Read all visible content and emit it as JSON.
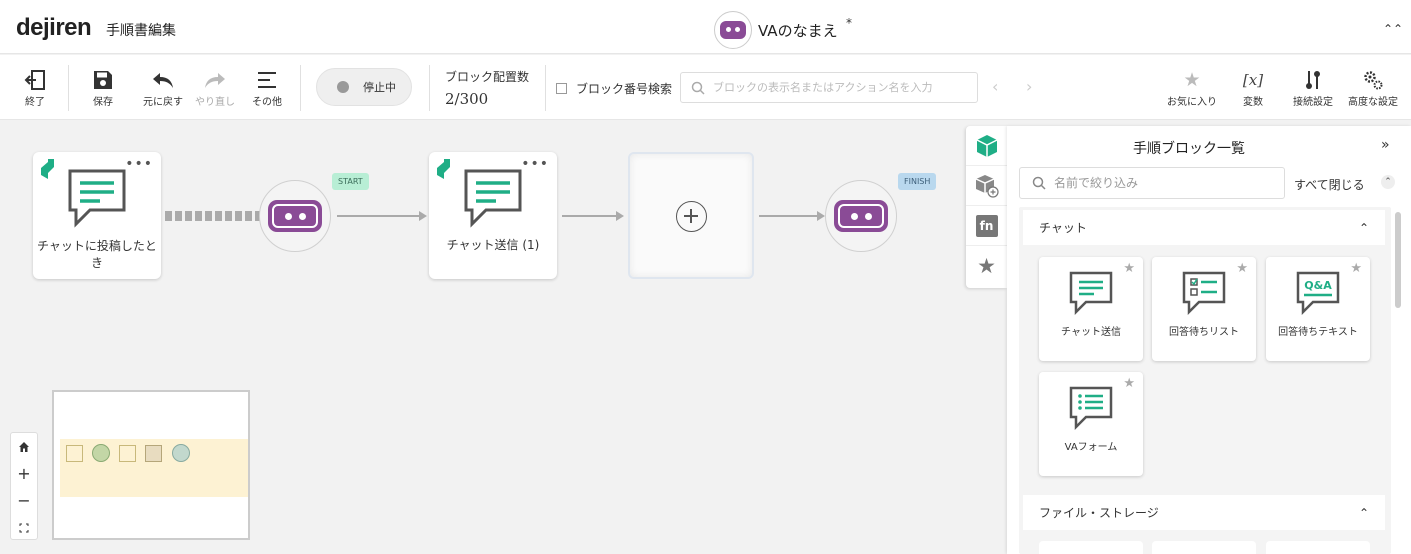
{
  "header": {
    "brand": "dejiren",
    "page_title": "手順書編集",
    "va_name": "VAのなまえ",
    "unsaved_mark": "*"
  },
  "toolbar": {
    "exit": "終了",
    "save": "保存",
    "undo": "元に戻す",
    "redo": "やり直し",
    "other": "その他",
    "toggle_label": "停止中",
    "block_count_title": "ブロック配置数",
    "block_count_value": "2/300",
    "block_number_search": "ブロック番号検索",
    "search_placeholder": "ブロックの表示名またはアクション名を入力",
    "favorites": "お気に入り",
    "variables": "変数",
    "connection_settings": "接続設定",
    "advanced_settings": "高度な設定"
  },
  "canvas": {
    "trigger_block_label": "チャットに投稿したとき",
    "send_block_label": "チャット送信 (1)",
    "start_flag": "START",
    "finish_flag": "FINISH"
  },
  "panel": {
    "title": "手順ブロック一覧",
    "filter_placeholder": "名前で絞り込み",
    "close_all": "すべて閉じる",
    "sections": [
      {
        "title": "チャット",
        "cards": [
          "チャット送信",
          "回答待ちリスト",
          "回答待ちテキスト",
          "VAフォーム"
        ]
      },
      {
        "title": "ファイル・ストレージ"
      }
    ]
  },
  "colors": {
    "brand_green": "#1fae86",
    "robot_purple": "#8a4b96",
    "start_flag": "#b8eed5",
    "finish_flag": "#b9d8ee"
  },
  "icons": [
    "exit-icon",
    "save-icon",
    "undo-icon",
    "redo-icon",
    "menu-icon",
    "search-icon",
    "star-icon",
    "variable-icon",
    "connection-icon",
    "gears-icon",
    "robot-icon",
    "chat-icon",
    "plus-icon",
    "home-icon",
    "fullscreen-icon"
  ]
}
